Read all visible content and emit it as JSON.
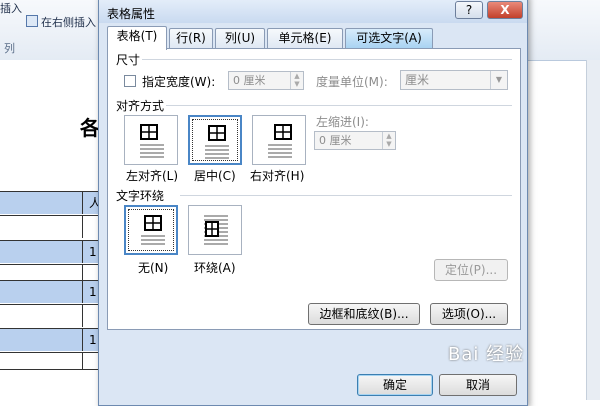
{
  "ribbon": {
    "insert_left_label": "插入",
    "insert_right_label": "在右侧插入",
    "group_label": "列"
  },
  "document": {
    "title_fragment": "各",
    "header_cell": "人",
    "row_values": [
      "1",
      "1",
      "1"
    ]
  },
  "dialog": {
    "title": "表格属性",
    "help_label": "?",
    "close_label": "X",
    "tabs": [
      {
        "label": "表格(T)"
      },
      {
        "label": "行(R)"
      },
      {
        "label": "列(U)"
      },
      {
        "label": "单元格(E)"
      },
      {
        "label": "可选文字(A)"
      }
    ],
    "size": {
      "section_label": "尺寸",
      "preferred_width_label": "指定宽度(W):",
      "preferred_width_value": "0 厘米",
      "measure_label": "度量单位(M):",
      "measure_value": "厘米"
    },
    "alignment": {
      "section_label": "对齐方式",
      "options": [
        {
          "label": "左对齐(L)"
        },
        {
          "label": "居中(C)"
        },
        {
          "label": "右对齐(H)"
        }
      ],
      "indent_label": "左缩进(I):",
      "indent_value": "0 厘米"
    },
    "wrapping": {
      "section_label": "文字环绕",
      "options": [
        {
          "label": "无(N)"
        },
        {
          "label": "环绕(A)"
        }
      ],
      "position_button": "定位(P)..."
    },
    "borders_button": "边框和底纹(B)...",
    "options_button": "选项(O)...",
    "ok_button": "确定",
    "cancel_button": "取消"
  },
  "watermark_text": "Bai 经验",
  "colors": {
    "dialog_bg": "#dbe6f4",
    "selection_border": "#4a86c6",
    "table_highlight": "#b9d0ee"
  }
}
